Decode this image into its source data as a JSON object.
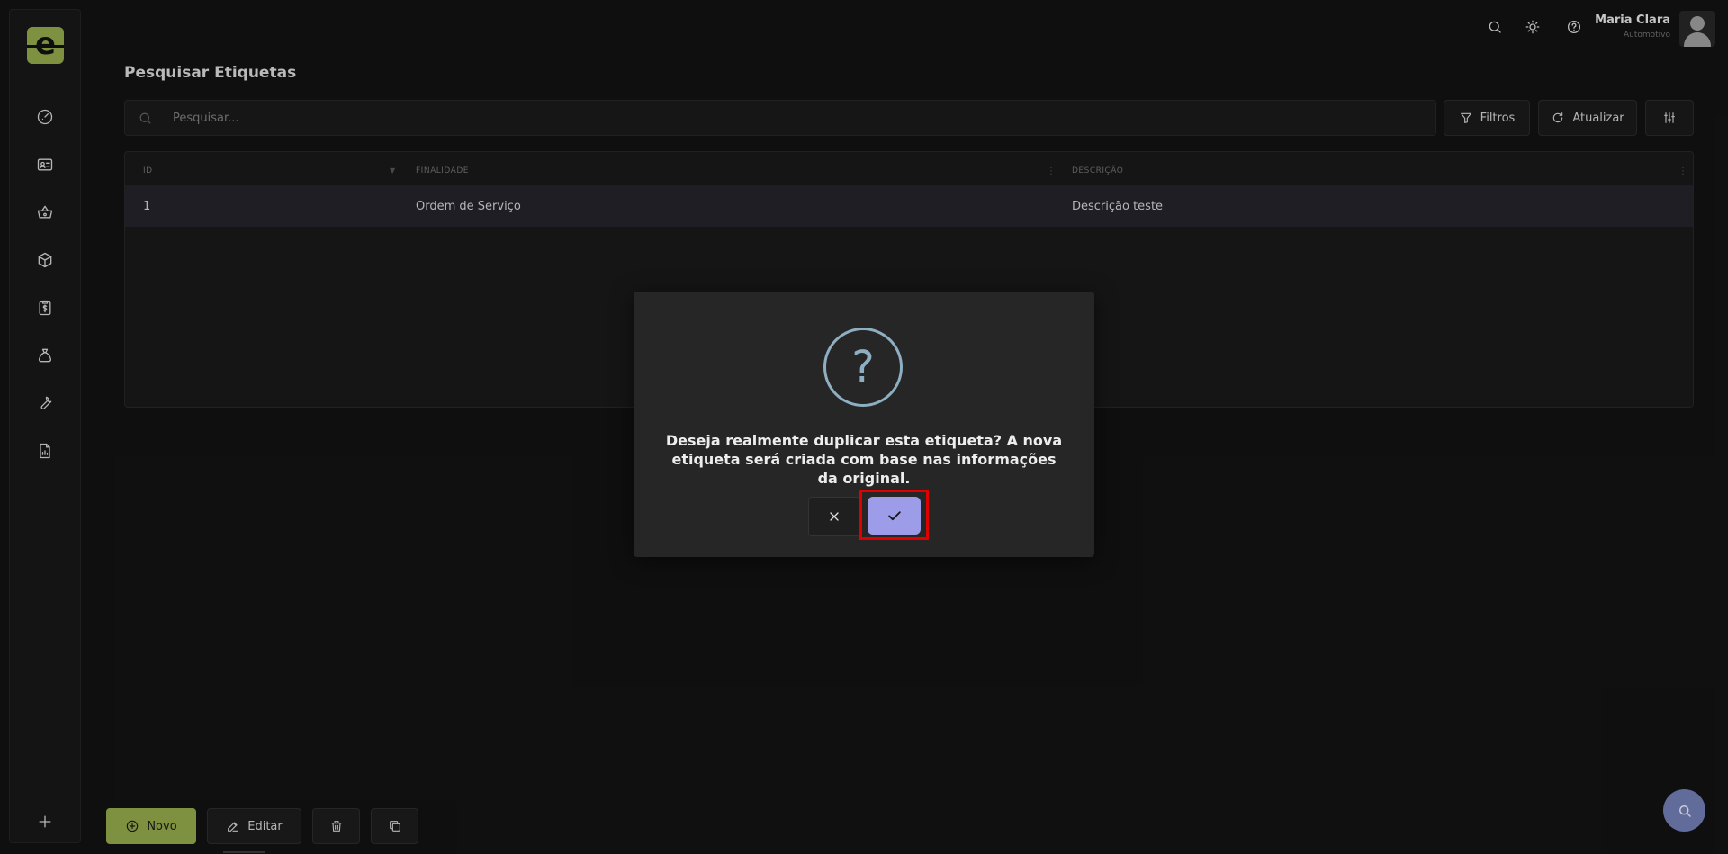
{
  "user": {
    "name": "Maria Clara",
    "role": "Automotivo"
  },
  "logo_letter": "e",
  "page": {
    "title": "Pesquisar Etiquetas"
  },
  "search": {
    "placeholder": "Pesquisar..."
  },
  "toolbar": {
    "filters_label": "Filtros",
    "refresh_label": "Atualizar"
  },
  "table": {
    "columns": [
      "ID",
      "FINALIDADE",
      "DESCRIÇÃO"
    ],
    "rows": [
      {
        "id": "1",
        "finalidade": "Ordem de Serviço",
        "descricao": "Descrição teste"
      }
    ]
  },
  "dialog": {
    "icon_glyph": "?",
    "message": "Deseja realmente duplicar esta etiqueta? A nova etiqueta será criada com base nas informações da original."
  },
  "actions": {
    "new_label": "Novo",
    "edit_label": "Editar"
  },
  "sidebar": {
    "icons": [
      "dashboard-icon",
      "contact-card-icon",
      "basket-icon",
      "package-icon",
      "billing-clipboard-icon",
      "money-bag-icon",
      "wrench-icon",
      "report-icon",
      "plus-icon"
    ]
  },
  "colors": {
    "brand": "#8fa54a",
    "confirm": "#9c9ce8",
    "highlight": "#e00000",
    "fab": "#6f7bb0"
  }
}
